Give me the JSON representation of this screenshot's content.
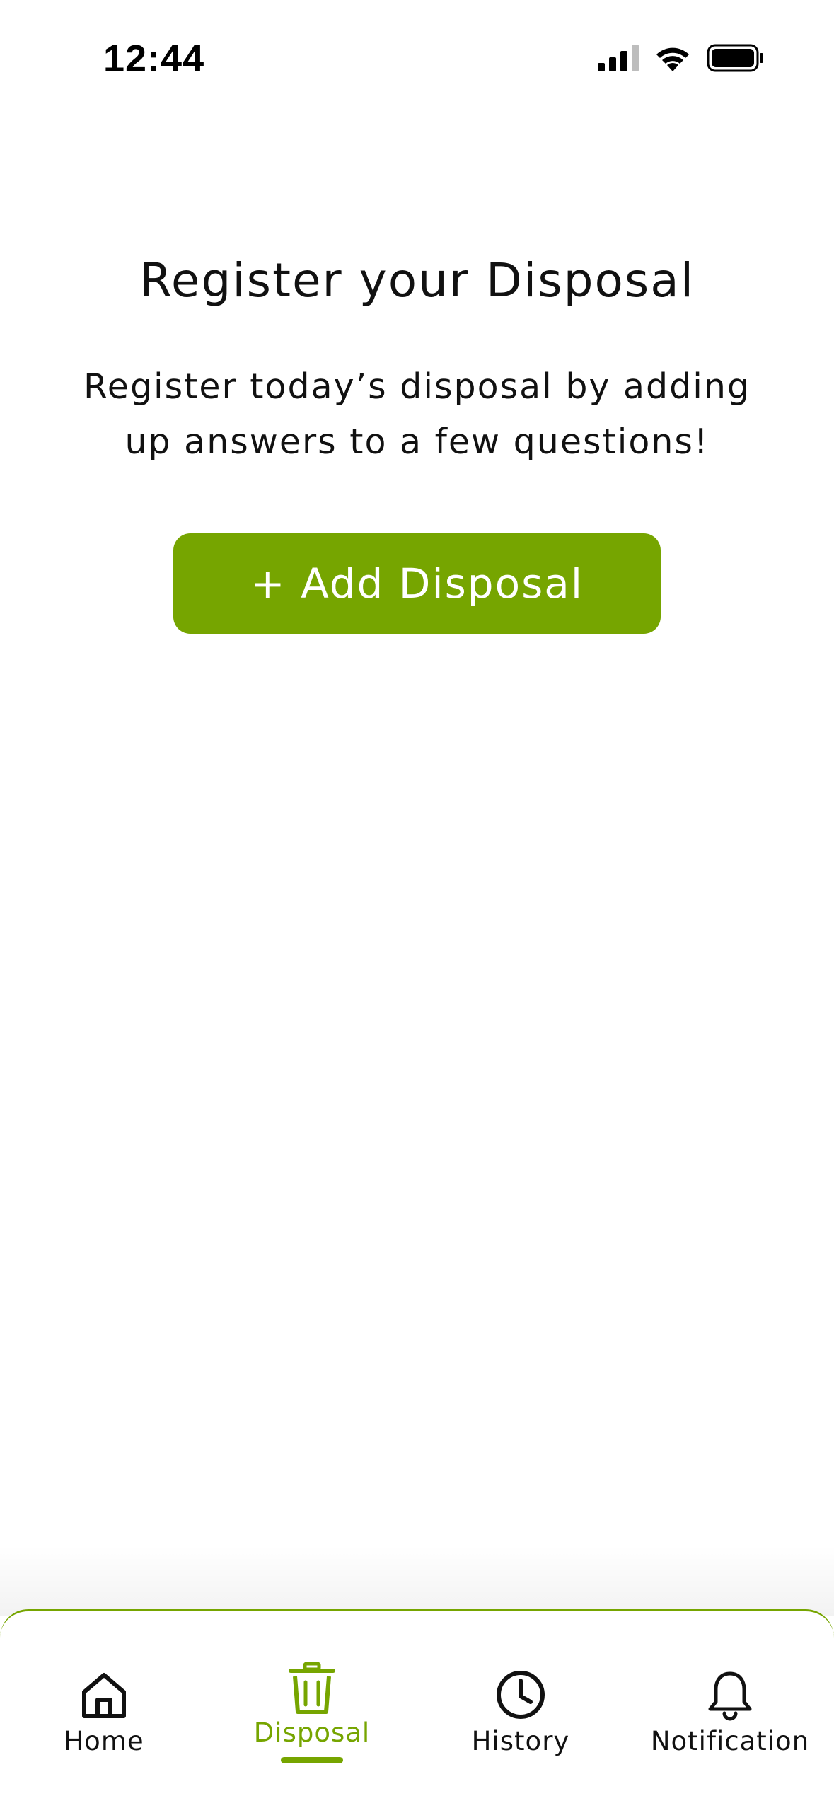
{
  "status_bar": {
    "time": "12:44",
    "icons": [
      "cellular-signal-icon",
      "wifi-icon",
      "battery-icon"
    ]
  },
  "main": {
    "title": "Register your Disposal",
    "subtitle": "Register today’s disposal by adding up answers to a few questions!",
    "add_button_label": "+ Add Disposal"
  },
  "tab_bar": {
    "active_tab": "Disposal",
    "items": [
      {
        "label": "Home",
        "icon": "home-icon"
      },
      {
        "label": "Disposal",
        "icon": "trash-icon"
      },
      {
        "label": "History",
        "icon": "clock-icon"
      },
      {
        "label": "Notification",
        "icon": "bell-icon"
      }
    ]
  },
  "colors": {
    "accent": "#76a500",
    "text": "#111111",
    "background": "#ffffff"
  }
}
